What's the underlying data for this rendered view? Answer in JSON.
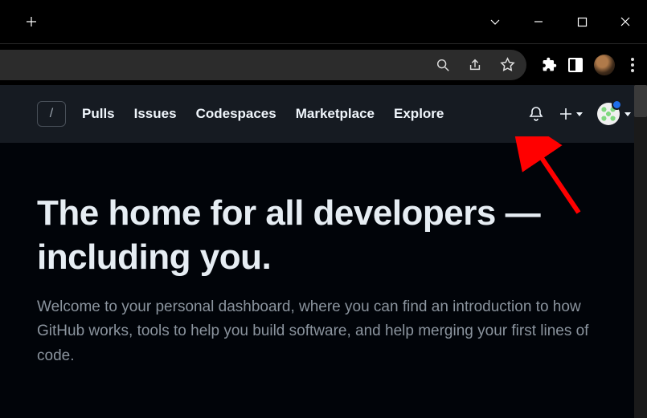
{
  "window": {
    "chevron_label": "tabs-dropdown"
  },
  "github_header": {
    "search_shortcut": "/",
    "nav": {
      "pulls": "Pulls",
      "issues": "Issues",
      "codespaces": "Codespaces",
      "marketplace": "Marketplace",
      "explore": "Explore"
    }
  },
  "main": {
    "hero_title": "The home for all developers — including you.",
    "hero_subtitle": "Welcome to your personal dashboard, where you can find an introduction to how GitHub works, tools to help you build software, and help merging your first lines of code."
  },
  "colors": {
    "gh_bg": "#161b22",
    "body_bg": "#010409",
    "text_primary": "#e6edf3",
    "text_muted": "#8b949e",
    "accent_blue": "#1f6feb",
    "annotation_red": "#ff0000"
  }
}
